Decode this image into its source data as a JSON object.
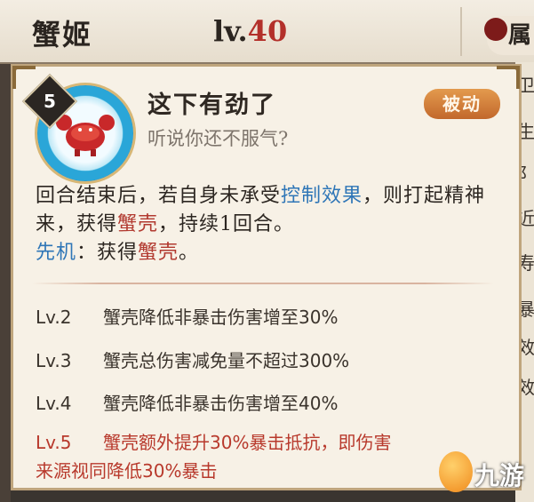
{
  "header": {
    "name": "蟹姬",
    "level_prefix": "lv.",
    "level_value": "40",
    "side_tab": "属"
  },
  "skill": {
    "level_badge": "5",
    "icon": "crab-icon",
    "title": "这下有劲了",
    "subtitle": "听说你还不服气?",
    "type_badge": "被动",
    "description": {
      "part1": "回合结束后，若自身未承受",
      "control": "控制效果",
      "part2": "，则打起精神来，获得",
      "shell": "蟹壳",
      "part3": "，持续1回合。"
    },
    "initiative": {
      "label": "先机",
      "part1": "：获得",
      "shell": "蟹壳",
      "part2": "。"
    },
    "upgrades": [
      {
        "level": "Lv.2",
        "text": "蟹壳降低非暴击伤害增至30%"
      },
      {
        "level": "Lv.3",
        "text": "蟹壳总伤害减免量不超过300%"
      },
      {
        "level": "Lv.4",
        "text": "蟹壳降低非暴击伤害增至40%"
      },
      {
        "level": "Lv.5",
        "text": "蟹壳额外提升30%暴击抵抗，即伤害",
        "text2": "来源视同降低30%暴击"
      }
    ]
  },
  "right_strip": [
    "卫",
    "生",
    "阝",
    "近",
    "寿",
    "暴",
    "效",
    "效"
  ],
  "watermark": {
    "text": "九游"
  },
  "colors": {
    "accent_red": "#b23a30",
    "accent_blue": "#2f76b7",
    "badge_orange": "#d9843c"
  }
}
